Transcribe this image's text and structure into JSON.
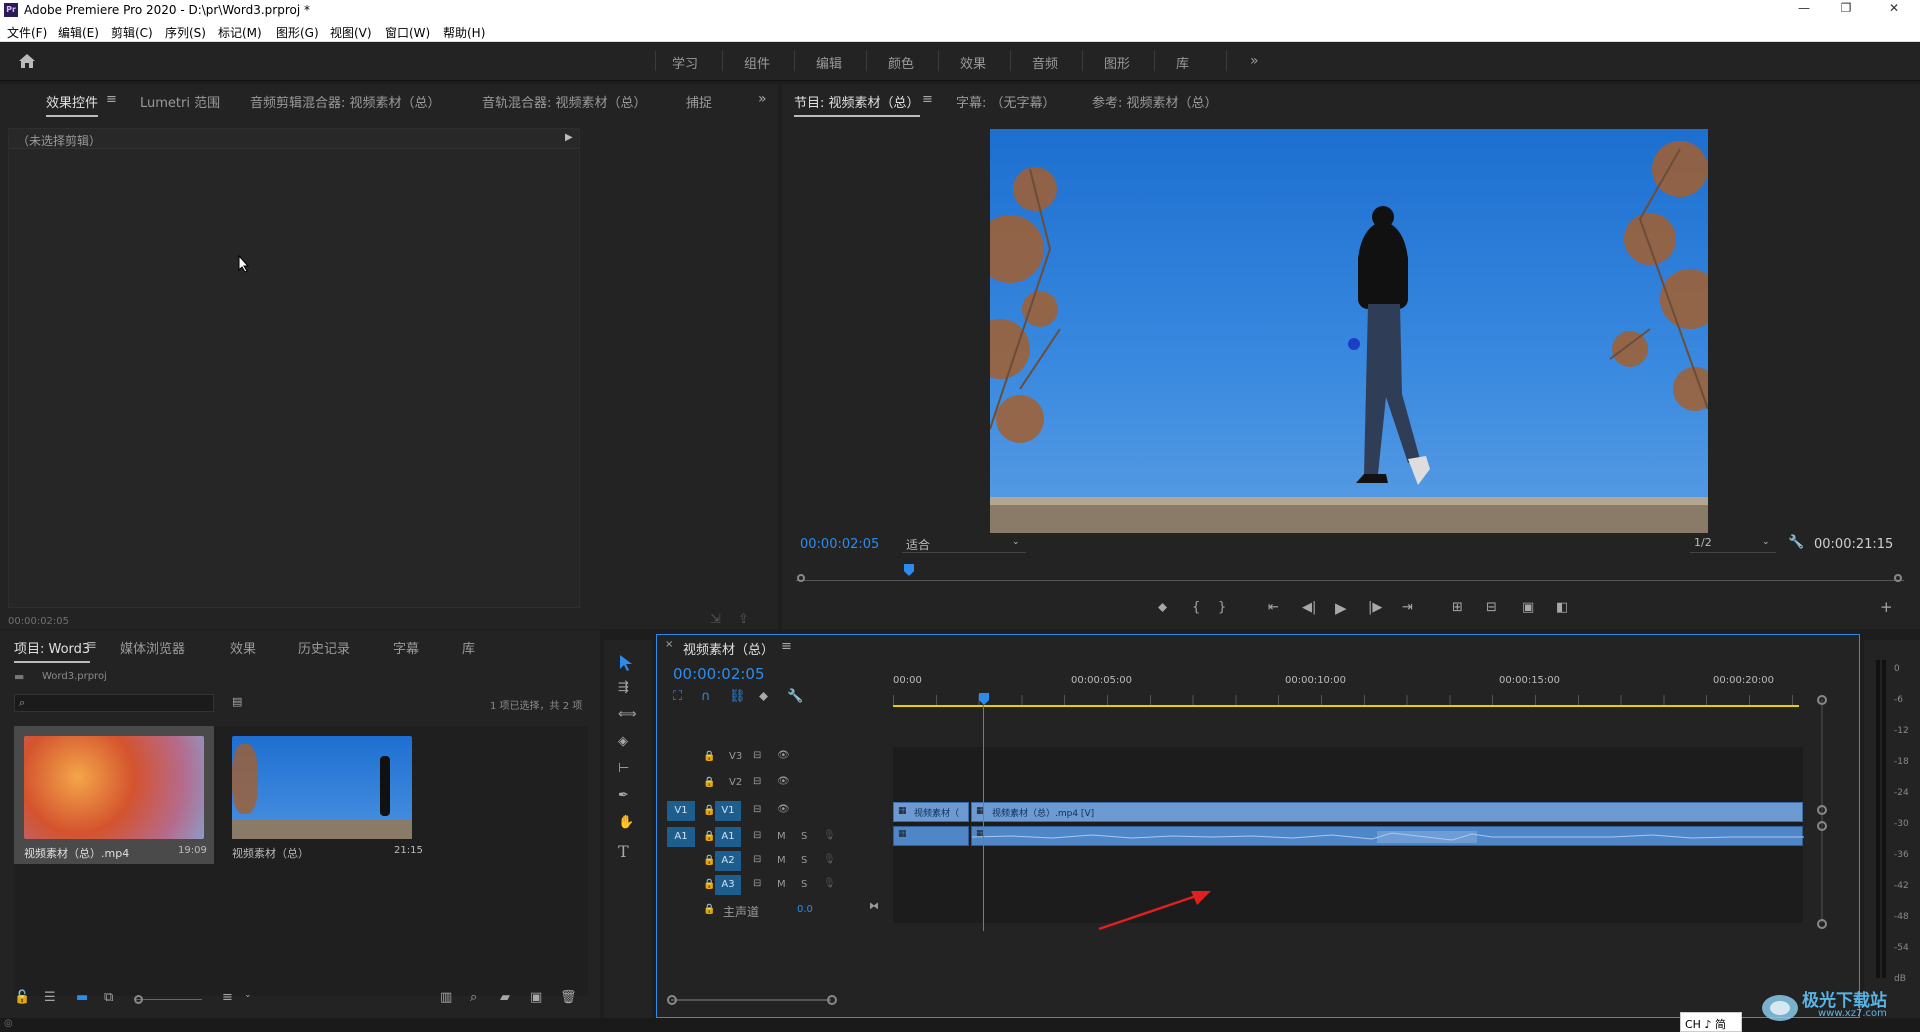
{
  "window": {
    "app_icon": "Pr",
    "title": "Adobe Premiere Pro 2020 - D:\\pr\\Word3.prproj *",
    "minimize": "—",
    "restore": "❐",
    "close": "✕"
  },
  "menu": [
    "文件(F)",
    "编辑(E)",
    "剪辑(C)",
    "序列(S)",
    "标记(M)",
    "图形(G)",
    "视图(V)",
    "窗口(W)",
    "帮助(H)"
  ],
  "workspaces": [
    "学习",
    "组件",
    "编辑",
    "颜色",
    "效果",
    "音频",
    "图形",
    "库"
  ],
  "top_left_panel": {
    "tabs": [
      "效果控件",
      "Lumetri 范围",
      "音频剪辑混合器: 视频素材（总）",
      "音轨混合器: 视频素材（总）",
      "捕捉"
    ],
    "no_clip": "（未选择剪辑）",
    "timecode": "00:00:02:05"
  },
  "program_monitor": {
    "tabs": [
      "节目: 视频素材（总）",
      "字幕: （无字幕）",
      "参考: 视频素材（总）"
    ],
    "timecode": "00:00:02:05",
    "fit": "适合",
    "resolution": "1/2",
    "duration": "00:00:21:15",
    "playhead_fraction": 0.102
  },
  "project_panel": {
    "tabs": [
      "项目: Word3",
      "媒体浏览器",
      "效果",
      "历史记录",
      "字幕",
      "库"
    ],
    "file": "Word3.prproj",
    "status": "1 项已选择，共 2 项",
    "items": [
      {
        "name": "视频素材（总）.mp4",
        "duration": "19:09"
      },
      {
        "name": "视频素材（总）",
        "duration": "21:15"
      }
    ]
  },
  "timeline": {
    "tab": "视频素材（总）",
    "timecode": "00:00:02:05",
    "ruler": [
      "00:00",
      "00:00:05:00",
      "00:00:10:00",
      "00:00:15:00",
      "00:00:20:00"
    ],
    "video_tracks": [
      "V3",
      "V2",
      "V1"
    ],
    "audio_tracks": [
      "A1",
      "A2",
      "A3"
    ],
    "master_label": "主声道",
    "master_value": "0.0",
    "source_v": "V1",
    "source_a": "A1",
    "mute": "M",
    "solo": "S",
    "clips": [
      {
        "label": "视频素材（"
      },
      {
        "label": "视频素材（总）.mp4 [V]"
      }
    ]
  },
  "meter_scale": [
    "0",
    "-6",
    "-12",
    "-18",
    "-24",
    "-30",
    "-36",
    "-42",
    "-48",
    "-54",
    "dB"
  ],
  "ime": "CH ♪ 简",
  "watermark": "极光下载站",
  "watermark_url": "www.xz7.com",
  "colors": {
    "accent": "#2d8ceb",
    "clip": "#6d9ad3",
    "arrow": "#e02020",
    "work_area": "#e8d000"
  }
}
